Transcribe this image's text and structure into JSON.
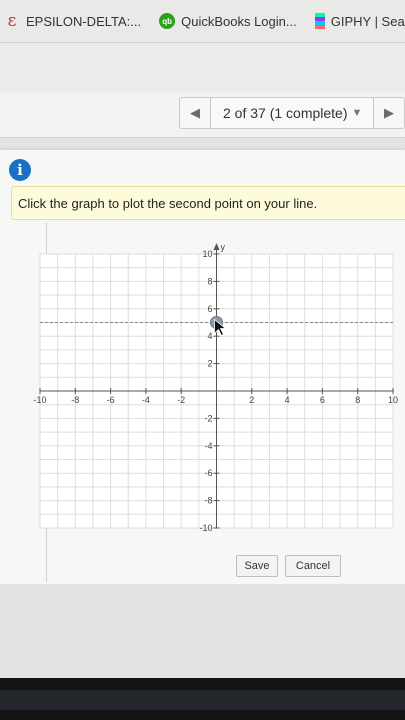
{
  "bookmarks": [
    {
      "label": "EPSILON-DELTA:...",
      "icon": "epsilon-icon"
    },
    {
      "label": "QuickBooks Login...",
      "icon": "quickbooks-icon"
    },
    {
      "label": "GIPHY | Sea",
      "icon": "giphy-icon"
    }
  ],
  "question_nav": {
    "prev_icon": "chevron-left-icon",
    "next_icon": "chevron-right-icon",
    "position_text": "2 of 37 (1 complete)",
    "dropdown_icon": "caret-down-icon"
  },
  "instruction": {
    "icon": "info-icon",
    "text": "Click the graph to plot the second point on your line."
  },
  "graph": {
    "x_axis_label": "",
    "y_axis_label": "y",
    "x_range": [
      -10,
      10
    ],
    "y_range": [
      -10,
      10
    ],
    "x_tick_labels": [
      "-10",
      "-8",
      "-6",
      "-4",
      "-2",
      "2",
      "4",
      "6",
      "8",
      "10"
    ],
    "y_tick_labels": [
      "10",
      "8",
      "6",
      "4",
      "2",
      "-2",
      "-4",
      "-6",
      "-8",
      "-10"
    ],
    "plotted_point": {
      "x": 0,
      "y": 5
    },
    "guide_line_y": 5
  },
  "buttons": {
    "save_label": "Save",
    "cancel_label": "Cancel"
  },
  "colors": {
    "accent": "#1a6fc7",
    "point": "#8d98a8",
    "instruction_bg": "#fdfbd9"
  }
}
